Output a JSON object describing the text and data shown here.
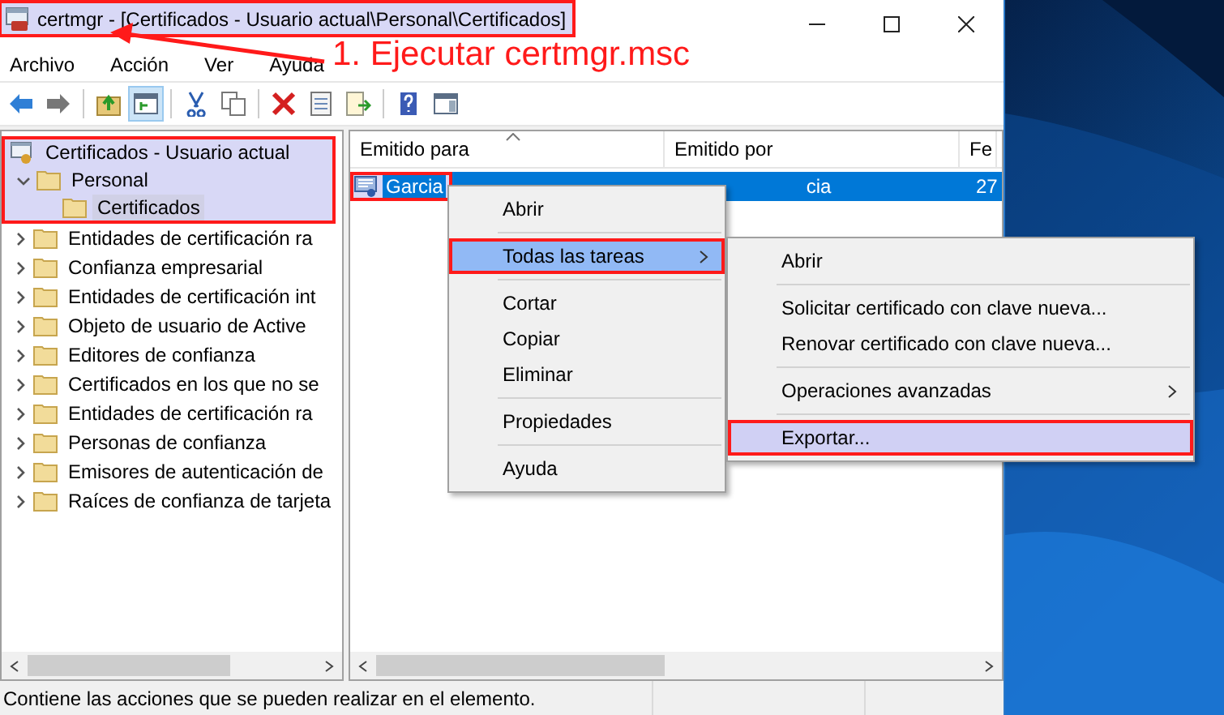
{
  "window": {
    "title": "certmgr - [Certificados - Usuario actual\\Personal\\Certificados]",
    "title_marked": true
  },
  "annotation": {
    "text": "1. Ejecutar certmgr.msc"
  },
  "menu_bar": [
    {
      "label": "Archivo"
    },
    {
      "label": "Acción"
    },
    {
      "label": "Ver"
    },
    {
      "label": "Ayuda"
    }
  ],
  "toolbar": [
    {
      "kind": "back",
      "pressed": false
    },
    {
      "kind": "forward",
      "pressed": false
    },
    {
      "kind": "separator"
    },
    {
      "kind": "up",
      "pressed": false
    },
    {
      "kind": "tree",
      "pressed": true
    },
    {
      "kind": "separator"
    },
    {
      "kind": "cut",
      "pressed": false
    },
    {
      "kind": "copy",
      "pressed": false
    },
    {
      "kind": "separator"
    },
    {
      "kind": "delete",
      "pressed": false
    },
    {
      "kind": "properties",
      "pressed": false
    },
    {
      "kind": "export",
      "pressed": false
    },
    {
      "kind": "separator"
    },
    {
      "kind": "help",
      "pressed": false
    },
    {
      "kind": "actionpane",
      "pressed": false
    }
  ],
  "tree": {
    "items": [
      {
        "label": "Certificados - Usuario actual",
        "kind": "store",
        "highlighted": true,
        "selected": false,
        "children": [
          {
            "label": "Personal",
            "kind": "folder",
            "expanded": true,
            "highlighted": true,
            "selected": false,
            "children": [
              {
                "label": "Certificados",
                "kind": "folder",
                "highlighted": true,
                "selected": true
              }
            ]
          },
          {
            "label": "Entidades de certificación ra",
            "kind": "folder",
            "expanded": false,
            "highlighted": false,
            "selected": false
          },
          {
            "label": "Confianza empresarial",
            "kind": "folder",
            "expanded": false,
            "highlighted": false,
            "selected": false
          },
          {
            "label": "Entidades de certificación int",
            "kind": "folder",
            "expanded": false,
            "highlighted": false,
            "selected": false
          },
          {
            "label": "Objeto de usuario de Active",
            "kind": "folder",
            "expanded": false,
            "highlighted": false,
            "selected": false
          },
          {
            "label": "Editores de confianza",
            "kind": "folder",
            "expanded": false,
            "highlighted": false,
            "selected": false
          },
          {
            "label": "Certificados en los que no se",
            "kind": "folder",
            "expanded": false,
            "highlighted": false,
            "selected": false
          },
          {
            "label": "Entidades de certificación ra",
            "kind": "folder",
            "expanded": false,
            "highlighted": false,
            "selected": false
          },
          {
            "label": "Personas de confianza",
            "kind": "folder",
            "expanded": false,
            "highlighted": false,
            "selected": false
          },
          {
            "label": "Emisores de autenticación de",
            "kind": "folder",
            "expanded": false,
            "highlighted": false,
            "selected": false
          },
          {
            "label": "Raíces de confianza de tarjeta",
            "kind": "folder",
            "expanded": false,
            "highlighted": false,
            "selected": false
          }
        ]
      }
    ]
  },
  "list": {
    "columns": [
      {
        "label": "Emitido para",
        "sorted": true
      },
      {
        "label": "Emitido por",
        "sorted": false
      },
      {
        "label": "Fe",
        "sorted": false
      }
    ],
    "rows": [
      {
        "cells": [
          "Garcia",
          "cia",
          "27"
        ],
        "selected": true,
        "marked": true
      }
    ]
  },
  "context_menu": {
    "items": [
      {
        "kind": "item",
        "label": "Abrir",
        "highlighted": false,
        "marked": false,
        "submenu": false
      },
      {
        "kind": "separator"
      },
      {
        "kind": "item",
        "label": "Todas las tareas",
        "highlighted": true,
        "marked": true,
        "submenu": true
      },
      {
        "kind": "separator"
      },
      {
        "kind": "item",
        "label": "Cortar",
        "highlighted": false,
        "marked": false,
        "submenu": false
      },
      {
        "kind": "item",
        "label": "Copiar",
        "highlighted": false,
        "marked": false,
        "submenu": false
      },
      {
        "kind": "item",
        "label": "Eliminar",
        "highlighted": false,
        "marked": false,
        "submenu": false
      },
      {
        "kind": "separator"
      },
      {
        "kind": "item",
        "label": "Propiedades",
        "highlighted": false,
        "marked": false,
        "submenu": false
      },
      {
        "kind": "separator"
      },
      {
        "kind": "item",
        "label": "Ayuda",
        "highlighted": false,
        "marked": false,
        "submenu": false
      }
    ]
  },
  "submenu": {
    "items": [
      {
        "kind": "item",
        "label": "Abrir",
        "highlighted": false,
        "marked": false,
        "submenu": false
      },
      {
        "kind": "separator"
      },
      {
        "kind": "item",
        "label": "Solicitar certificado con clave nueva...",
        "highlighted": false,
        "marked": false,
        "submenu": false
      },
      {
        "kind": "item",
        "label": "Renovar certificado con clave nueva...",
        "highlighted": false,
        "marked": false,
        "submenu": false
      },
      {
        "kind": "separator"
      },
      {
        "kind": "item",
        "label": "Operaciones avanzadas",
        "highlighted": false,
        "marked": false,
        "submenu": true
      },
      {
        "kind": "separator"
      },
      {
        "kind": "item",
        "label": "Exportar...",
        "highlighted": true,
        "marked": true,
        "submenu": false
      }
    ]
  },
  "status_bar": {
    "text": "Contiene las acciones que se pueden realizar en el elemento."
  }
}
